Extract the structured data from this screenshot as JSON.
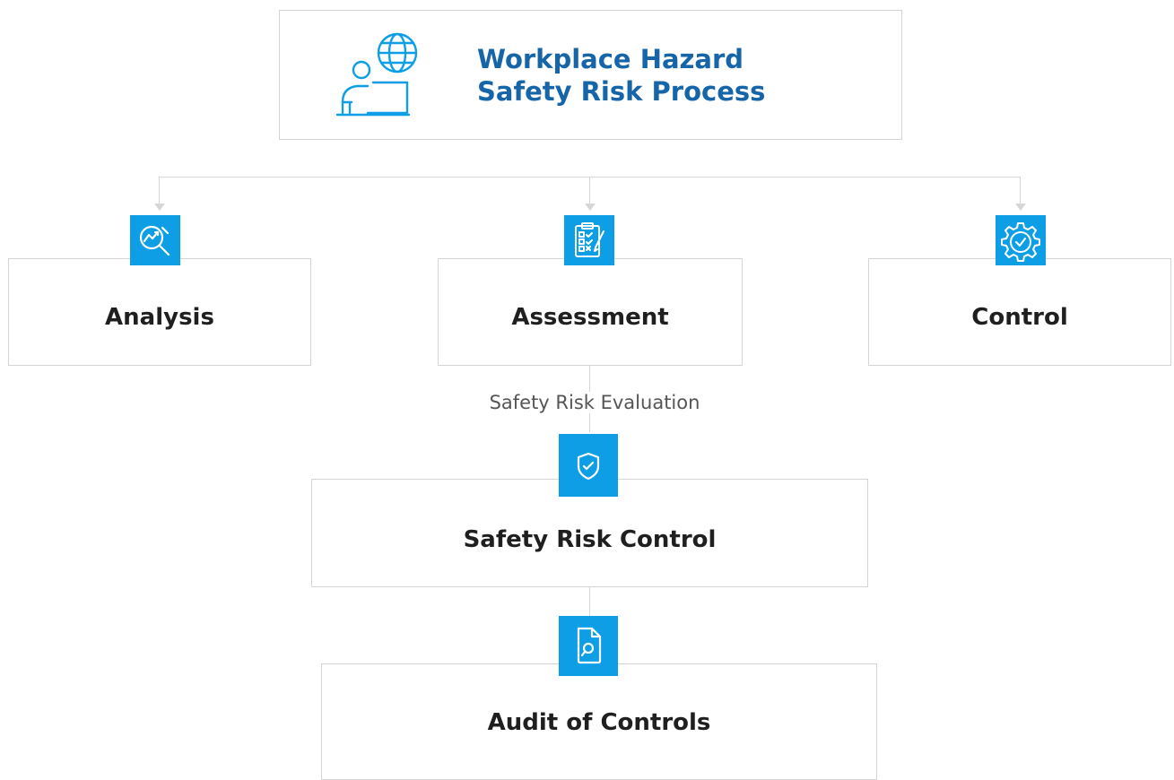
{
  "header": {
    "title_line1": "Workplace Hazard",
    "title_line2": "Safety Risk Process",
    "icon": "person-at-laptop-globe-icon"
  },
  "branches": [
    {
      "label": "Analysis",
      "icon": "magnifier-trend-icon"
    },
    {
      "label": "Assessment",
      "icon": "clipboard-checklist-icon"
    },
    {
      "label": "Control",
      "icon": "gear-check-icon"
    }
  ],
  "flow": {
    "connector_label": "Safety Risk Evaluation",
    "steps": [
      {
        "label": "Safety Risk Control",
        "icon": "shield-check-icon"
      },
      {
        "label": "Audit of Controls",
        "icon": "document-search-icon"
      }
    ]
  },
  "colors": {
    "accent": "#0d9ee6",
    "title": "#1565a8",
    "text": "#1f1f1f",
    "border": "#d4d4d4",
    "line": "#d6d6d6"
  }
}
